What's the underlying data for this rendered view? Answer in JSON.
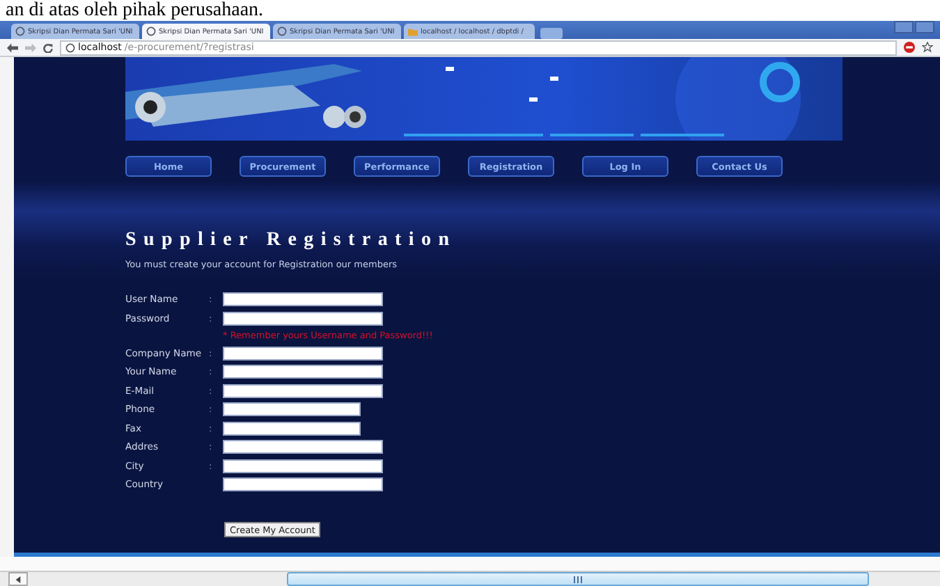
{
  "document_text": "an di atas oleh pihak perusahaan.",
  "browser": {
    "tabs": [
      {
        "title": "Skripsi Dian Permata Sari 'UNI",
        "selected": false
      },
      {
        "title": "Skripsi Dian Permata Sari 'UNI",
        "selected": true
      },
      {
        "title": "Skripsi Dian Permata Sari 'UNI",
        "selected": false
      },
      {
        "title": "localhost / localhost / dbptdi /",
        "selected": false
      }
    ],
    "url_host": "localhost",
    "url_path": "/e-procurement/?registrasi"
  },
  "nav": [
    {
      "label": "Home"
    },
    {
      "label": "Procurement"
    },
    {
      "label": "Performance"
    },
    {
      "label": "Registration"
    },
    {
      "label": "Log In"
    },
    {
      "label": "Contact Us"
    }
  ],
  "title": "Supplier Registration",
  "subtitle": "You must create your account for Registration our members",
  "fields": [
    {
      "label": "User Name",
      "separator": ":",
      "kind": "long"
    },
    {
      "label": "Password",
      "separator": ":",
      "kind": "long",
      "note": "* Remember yours Username and Password!!!"
    },
    {
      "label": "Company Name",
      "separator": ":",
      "kind": "long"
    },
    {
      "label": "Your Name",
      "separator": ":",
      "kind": "long"
    },
    {
      "label": "E-Mail",
      "separator": ":",
      "kind": "long"
    },
    {
      "label": "Phone",
      "separator": ":",
      "kind": "short"
    },
    {
      "label": "Fax",
      "separator": ":",
      "kind": "short"
    },
    {
      "label": "Addres",
      "separator": ":",
      "kind": "long"
    },
    {
      "label": "City",
      "separator": ":",
      "kind": "long"
    },
    {
      "label": "Country",
      "kind": "long"
    }
  ],
  "submit": "Create My Account"
}
